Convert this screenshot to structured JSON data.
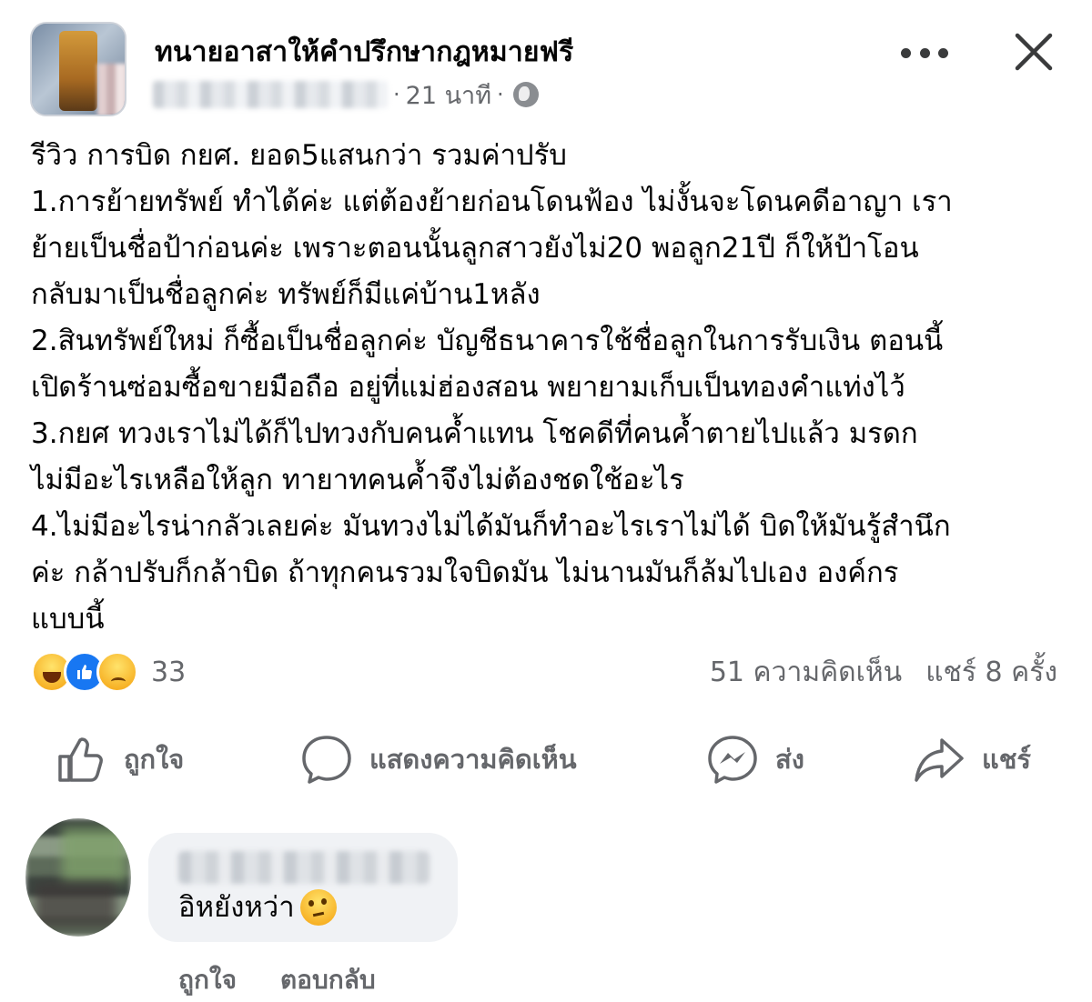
{
  "post": {
    "page_name": "ทนายอาสาให้คำปรึกษากฎหมายฟรี",
    "time": "21 นาที",
    "separator": "·",
    "body_lines": [
      "รีวิว การบิด กยศ. ยอด5แสนกว่า รวมค่าปรับ",
      "1.การย้ายทรัพย์ ทำได้ค่ะ แต่ต้องย้ายก่อนโดนฟ้อง ไม่งั้นจะโดนคดีอาญา เรา",
      "ย้ายเป็นชื่อป้าก่อนค่ะ เพราะตอนนั้นลูกสาวยังไม่20 พอลูก21ปี ก็ให้ป้าโอน",
      "กลับมาเป็นชื่อลูกค่ะ ทรัพย์ก็มีแค่บ้าน1หลัง",
      "2.สินทรัพย์ใหม่ ก็ซื้อเป็นชื่อลูกค่ะ บัญชีธนาคารใช้ชื่อลูกในการรับเงิน ตอนนี้",
      "เปิดร้านซ่อมซื้อขายมือถือ อยู่ที่แม่ฮ่องสอน พยายามเก็บเป็นทองคำแท่งไว้",
      "3.กยศ ทวงเราไม่ได้ก็ไปทวงกับคนค้ำแทน โชคดีที่คนค้ำตายไปแล้ว มรดก",
      "ไม่มีอะไรเหลือให้ลูก ทายาทคนค้ำจึงไม่ต้องชดใช้อะไร",
      "4.ไม่มีอะไรน่ากลัวเลยค่ะ มันทวงไม่ได้มันก็ทำอะไรเราไม่ได้ บิดให้มันรู้สำนึก",
      "ค่ะ กล้าปรับก็กล้าบิด ถ้าทุกคนรวมใจบิดมัน ไม่นานมันก็ล้มไปเอง องค์กร",
      "แบบนี้"
    ],
    "reaction_count": "33",
    "comments_count": "51 ความคิดเห็น",
    "shares_count": "แชร์ 8 ครั้ง"
  },
  "actions": {
    "like": "ถูกใจ",
    "comment": "แสดงความคิดเห็น",
    "send": "ส่ง",
    "share": "แชร์"
  },
  "comment": {
    "text": "อิหยังหว่า",
    "like": "ถูกใจ",
    "reply": "ตอบกลับ"
  },
  "colors": {
    "text": "#050505",
    "secondary": "#65676b",
    "like_blue": "#1877f2",
    "bubble": "#f0f2f5"
  },
  "icons": [
    "more-icon",
    "close-icon",
    "globe-icon",
    "haha-icon",
    "like-icon",
    "sad-icon",
    "thumbs-up-icon",
    "comment-icon",
    "messenger-icon",
    "share-icon",
    "thinking-face-icon"
  ]
}
